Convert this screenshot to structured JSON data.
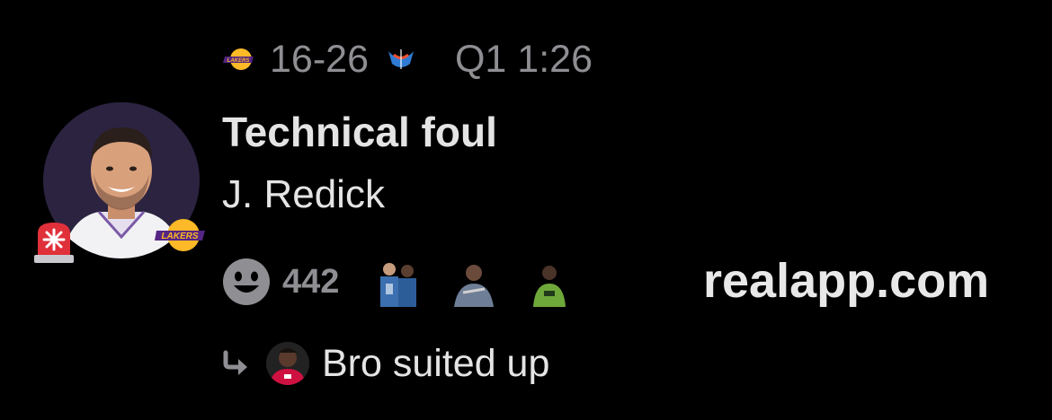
{
  "scoreline": {
    "home_team_icon": "lakers-logo-icon",
    "score": "16-26",
    "away_team_icon": "thunder-logo-icon",
    "period_clock": "Q1 1:26"
  },
  "event": {
    "title": "Technical foul",
    "player": "J. Redick",
    "player_avatar": "player-headshot",
    "team_badge": "lakers-logo-icon",
    "alert_icon": "siren-icon"
  },
  "reactions": {
    "icon": "smile-icon",
    "count": "442",
    "thumbnails": [
      "reaction-gif-1",
      "reaction-gif-2",
      "reaction-gif-3"
    ]
  },
  "watermark": "realapp.com",
  "reply": {
    "icon": "reply-arrow-icon",
    "avatar": "reply-user-avatar",
    "text": "Bro suited up"
  },
  "colors": {
    "background": "#000000",
    "text_primary": "#e4e4e4",
    "text_secondary": "#8e8e93",
    "lakers_purple": "#552583",
    "lakers_gold": "#fdb927",
    "alert_red": "#e0303a",
    "avatar_bg": "#2b2340"
  }
}
